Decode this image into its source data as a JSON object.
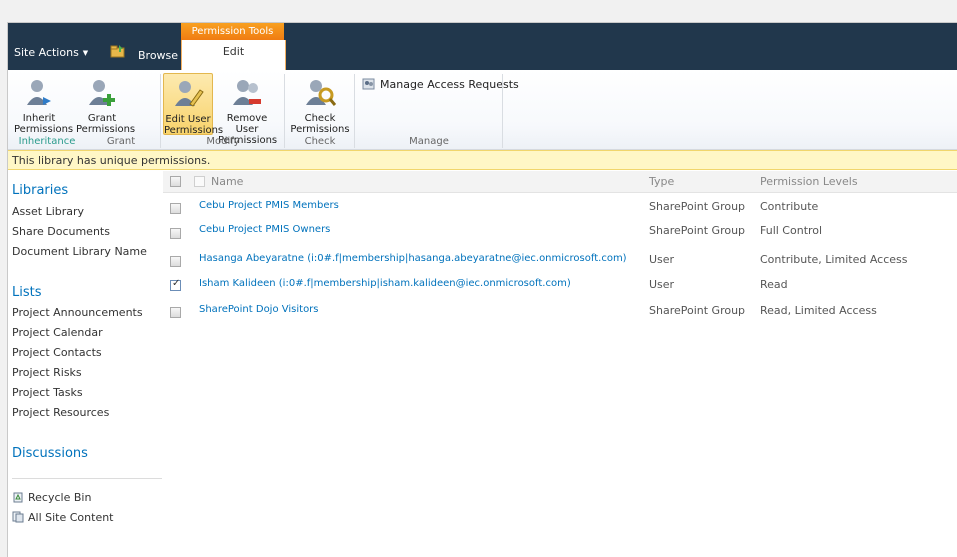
{
  "topbar": {
    "site_actions": "Site Actions",
    "browse": "Browse",
    "contextual_group": "Permission Tools",
    "active_tab": "Edit"
  },
  "ribbon": {
    "buttons": {
      "inherit": "Inherit Permissions",
      "grant": "Grant Permissions",
      "edit_user": "Edit User Permissions",
      "remove_user": "Remove User Permissions",
      "check": "Check Permissions",
      "manage_access": "Manage Access Requests"
    },
    "groups": {
      "inheritance": "Inheritance",
      "grant": "Grant",
      "modify": "Modify",
      "check": "Check",
      "manage": "Manage"
    }
  },
  "infobar": {
    "message": "This library has unique permissions."
  },
  "leftnav": {
    "libraries_head": "Libraries",
    "libraries": [
      "Asset Library",
      "Share Documents",
      "Document Library Name"
    ],
    "lists_head": "Lists",
    "lists": [
      "Project Announcements",
      "Project Calendar",
      "Project Contacts",
      "Project Risks",
      "Project Tasks",
      "Project Resources"
    ],
    "discussions_head": "Discussions",
    "recycle_bin": "Recycle Bin",
    "all_site_content": "All Site Content"
  },
  "table": {
    "columns": {
      "name": "Name",
      "type": "Type",
      "levels": "Permission Levels"
    },
    "rows": [
      {
        "name": "Cebu Project PMIS Members",
        "type": "SharePoint Group",
        "levels": "Contribute",
        "checked": false
      },
      {
        "name": "Cebu Project PMIS Owners",
        "type": "SharePoint Group",
        "levels": "Full Control",
        "checked": false
      },
      {
        "name": "Hasanga Abeyaratne (i:0#.f|membership|hasanga.abeyaratne@iec.onmicrosoft.com)",
        "type": "User",
        "levels": "Contribute, Limited Access",
        "checked": false
      },
      {
        "name": "Isham Kalideen (i:0#.f|membership|isham.kalideen@iec.onmicrosoft.com)",
        "type": "User",
        "levels": "Read",
        "checked": true
      },
      {
        "name": "SharePoint Dojo Visitors",
        "type": "SharePoint Group",
        "levels": "Read, Limited Access",
        "checked": false
      }
    ]
  },
  "colors": {
    "topbar": "#21374c",
    "accent": "#f07c12",
    "link": "#0072bc",
    "infobar": "#fff7c6"
  }
}
